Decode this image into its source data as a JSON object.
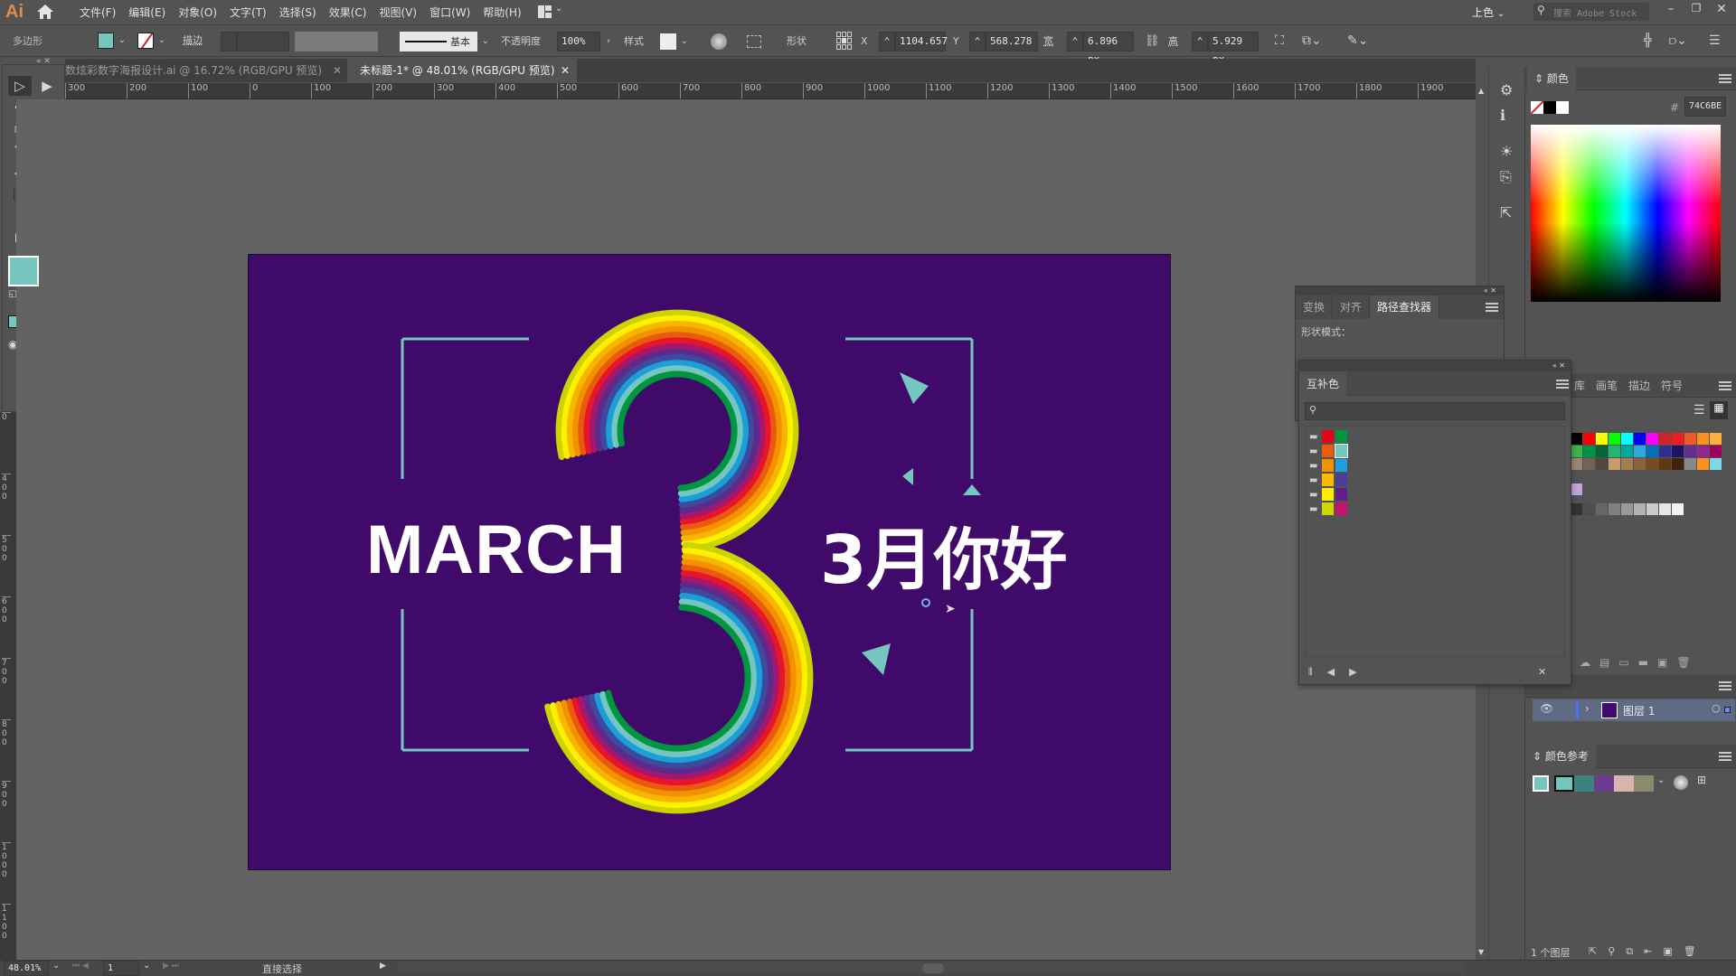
{
  "app": {
    "logo": "Ai",
    "menu": [
      "文件(F)",
      "编辑(E)",
      "对象(O)",
      "文字(T)",
      "选择(S)",
      "效果(C)",
      "视图(V)",
      "窗口(W)",
      "帮助(H)"
    ],
    "workspace": "上色",
    "search_placeholder": "搜索 Adobe Stock"
  },
  "control_bar": {
    "object_type": "多边形",
    "fill_color": "#74C6BE",
    "stroke_label": "描边",
    "stroke_style": "基本",
    "opacity_label": "不透明度",
    "opacity_value": "100%",
    "style_label": "样式",
    "shape_label": "形状",
    "x_label": "X",
    "x_value": "1104.657",
    "y_label": "Y",
    "y_value": "568.278 px",
    "w_label": "宽",
    "w_value": "6.896 px",
    "h_label": "高",
    "h_value": "5.929 px"
  },
  "tabs": [
    {
      "label": "数炫彩数字海报设计.ai @ 16.72% (RGB/GPU 预览)",
      "active": false
    },
    {
      "label": "未标题-1* @ 48.01% (RGB/GPU 预览)",
      "active": true
    }
  ],
  "ruler": {
    "h_ticks": [
      "300",
      "200",
      "100",
      "0",
      "100",
      "200",
      "300",
      "400",
      "500",
      "600",
      "700",
      "800",
      "900",
      "1000",
      "1100",
      "1200",
      "1300",
      "1400",
      "1500",
      "1600",
      "1700",
      "1800",
      "1900"
    ],
    "v_ticks": [
      "0",
      "4 0 0",
      "5 0 0",
      "6 0 0",
      "7 0 0",
      "8 0 0",
      "9 0 0",
      "1 0 0 0",
      "1 1 0 0"
    ]
  },
  "artwork": {
    "english": "MARCH",
    "chinese": "3月你好",
    "background": "#3f0a69",
    "frame_color": "#74c6be",
    "stripe_colors": [
      "#e8142a",
      "#ea5a0e",
      "#f39200",
      "#f7b500",
      "#fff000",
      "#cbd300",
      "#00963f",
      "#74c6be",
      "#1a9fd9",
      "#3d4b9c",
      "#5c2a8a",
      "#a3186f"
    ]
  },
  "panels": {
    "color": {
      "title": "颜色",
      "hex_label": "#",
      "hex_value": "74C6BE"
    },
    "pathfinder": {
      "tabs": [
        "变换",
        "对齐",
        "路径查找器"
      ],
      "shape_modes_label": "形状模式："
    },
    "complementary": {
      "title": "互补色",
      "rows": [
        [
          "#e30613",
          "#009640"
        ],
        [
          "#ea5b0c",
          "#74c6be"
        ],
        [
          "#f39200",
          "#1ba1e2"
        ],
        [
          "#fbb900",
          "#4a3e98"
        ],
        [
          "#ffed00",
          "#641e8c"
        ],
        [
          "#d2d600",
          "#c3126f"
        ]
      ]
    },
    "swatches": {
      "tabs": [
        "库",
        "画笔",
        "描边",
        "符号"
      ],
      "row1": [
        "#000000",
        "#ff0000",
        "#ffff00",
        "#00ff00",
        "#00ffff",
        "#0000ff",
        "#ff00ff",
        "#d2232a",
        "#ed1c24",
        "#f15a24",
        "#f7931e",
        "#fbb03b"
      ],
      "row2": [
        "#39b54a",
        "#009245",
        "#006837",
        "#22b573",
        "#00a99d",
        "#29abe2",
        "#0071bc",
        "#2e3192",
        "#1b1464",
        "#662d91",
        "#93278f",
        "#9e005d"
      ],
      "row3": [
        "#998675",
        "#736357",
        "#534741",
        "#c69c6d",
        "#a67c52",
        "#8c6239",
        "#754c24",
        "#603813",
        "#42210b",
        "#888888",
        "#f7931e",
        "#7fd7e8"
      ],
      "gray": [
        "#333333",
        "#4d4d4d",
        "#666666",
        "#808080",
        "#999999",
        "#b3b3b3",
        "#cccccc",
        "#e6e6e6",
        "#f2f2f2"
      ],
      "single": "#c2a5d8"
    },
    "layers": {
      "layer_name": "图层 1",
      "count_label": "1 个图层"
    },
    "color_guide": {
      "title": "颜色参考",
      "colors": [
        "#74c6be",
        "#3b847e",
        "#6e3c8f",
        "#d8b5ac",
        "#8a8a6e"
      ]
    }
  },
  "status": {
    "zoom": "48.01%",
    "page": "1",
    "tool": "直接选择"
  }
}
